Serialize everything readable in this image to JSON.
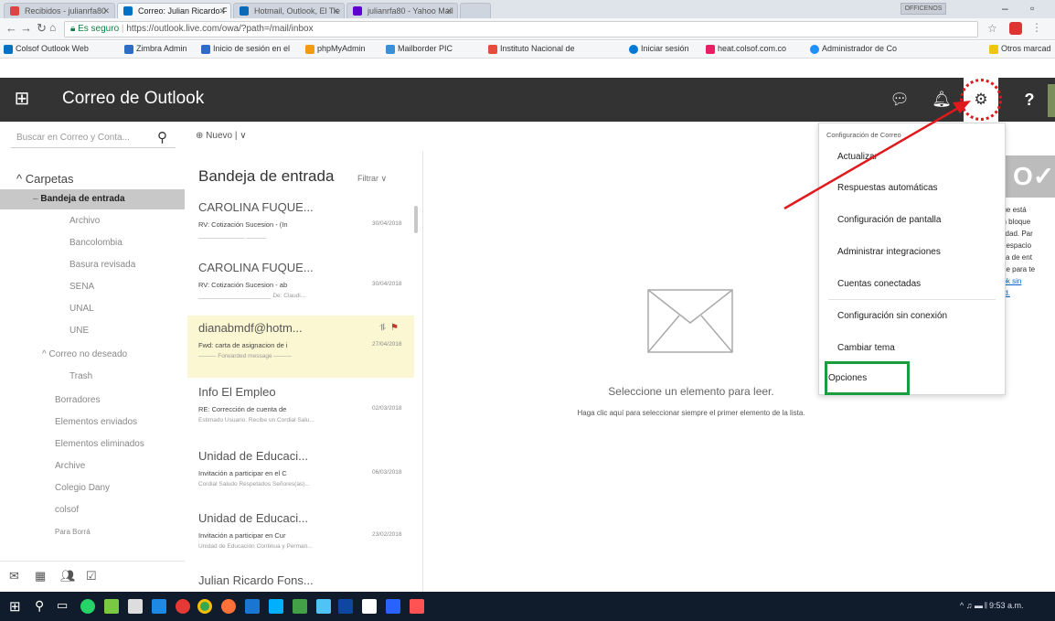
{
  "browser": {
    "tabs": [
      {
        "label": "Recibidos - julianrfa80",
        "active": false
      },
      {
        "label": "Correo: Julian Ricardo F",
        "active": true
      },
      {
        "label": "Hotmail, Outlook, El Tie",
        "active": false
      },
      {
        "label": "julianrfa80 - Yahoo Mail",
        "active": false
      }
    ],
    "profile_chip": "OFFICENOS",
    "address": {
      "secure_label": "Es seguro",
      "url": "https://outlook.live.com/owa/?path=/mail/inbox"
    },
    "bookmarks": [
      "Colsof Outlook Web",
      "Zimbra Admin",
      "Inicio de sesión en el",
      "phpMyAdmin",
      "Mailborder PIC",
      "Instituto Nacional de",
      "Iniciar sesión",
      "heat.colsof.com.co",
      "Administrador de Co",
      "Otros marcad"
    ]
  },
  "header": {
    "title": "Correo de Outlook",
    "help": "?"
  },
  "toolbar": {
    "search_placeholder": "Buscar en Correo y Conta...",
    "new_label": "⊕ Nuevo | ∨"
  },
  "folders": {
    "section_label": "^ Carpetas",
    "items": [
      "Bandeja de entrada",
      "Archivo",
      "Bancolombia",
      "Basura revisada",
      "SENA",
      "UNAL",
      "UNE",
      "Correo no deseado",
      "Trash",
      "Borradores",
      "Elementos enviados",
      "Elementos eliminados",
      "Archive",
      "Colegio Dany",
      "colsof",
      "Para Borrá"
    ]
  },
  "list": {
    "title": "Bandeja de entrada",
    "filter_label": "Filtrar ∨",
    "messages": [
      {
        "sender": "CAROLINA FUQUE...",
        "subject": "RV: Cotización Sucesion - (In",
        "date": "30/04/2018",
        "preview": "______________ ______"
      },
      {
        "sender": "CAROLINA FUQUE...",
        "subject": "RV: Cotización Sucesion - ab",
        "date": "30/04/2018",
        "preview": "______________________ De: Claudi..."
      },
      {
        "sender": "dianabmdf@hotm...",
        "subject": "Fwd: carta de asignacion de i",
        "date": "27/04/2018",
        "preview": "——— Forwarded message ———"
      },
      {
        "sender": "Info El Empleo",
        "subject": "RE: Corrección de cuenta de",
        "date": "02/03/2018",
        "preview": "Estimado Usuario. Recibe un Cordial Salu..."
      },
      {
        "sender": "Unidad de Educaci...",
        "subject": "Invitación a participar en el C",
        "date": "06/03/2018",
        "preview": "Cordial Saludo Respetados Señores(as)..."
      },
      {
        "sender": "Unidad de Educaci...",
        "subject": "Invitación a participar en Cur",
        "date": "23/02/2018",
        "preview": "Unidad de Educación Continua y Perman..."
      },
      {
        "sender": "Julian Ricardo Fons...",
        "subject": "",
        "date": "",
        "preview": ""
      }
    ]
  },
  "reading": {
    "title": "Seleccione un elemento para leer.",
    "hint": "Haga clic aquí para seleccionar siempre el primer elemento de la lista."
  },
  "ad": {
    "lines": [
      "que está",
      "un bloque",
      "icidad. Par",
      "el espacio",
      "leja de ent",
      "ase para te"
    ],
    "links": [
      "ook sin",
      "lad."
    ]
  },
  "settings_menu": {
    "header": "Configuración de Correo",
    "items": [
      "Actualizar",
      "Respuestas automáticas",
      "Configuración de pantalla",
      "Administrar integraciones",
      "Cuentas conectadas",
      "Configuración sin conexión",
      "Cambiar tema",
      "Opciones"
    ]
  },
  "taskbar": {
    "tray_text": "^ ♫ ▬ 𝄃 9:53 a.m."
  },
  "colors": {
    "header_bg": "#333333",
    "highlight_row": "#fcf7d3",
    "selected_folder": "#c8c8c8",
    "annotation_red": "#e0191c",
    "annotation_green": "#1a9e3d",
    "taskbar_bg": "#101c2c"
  }
}
